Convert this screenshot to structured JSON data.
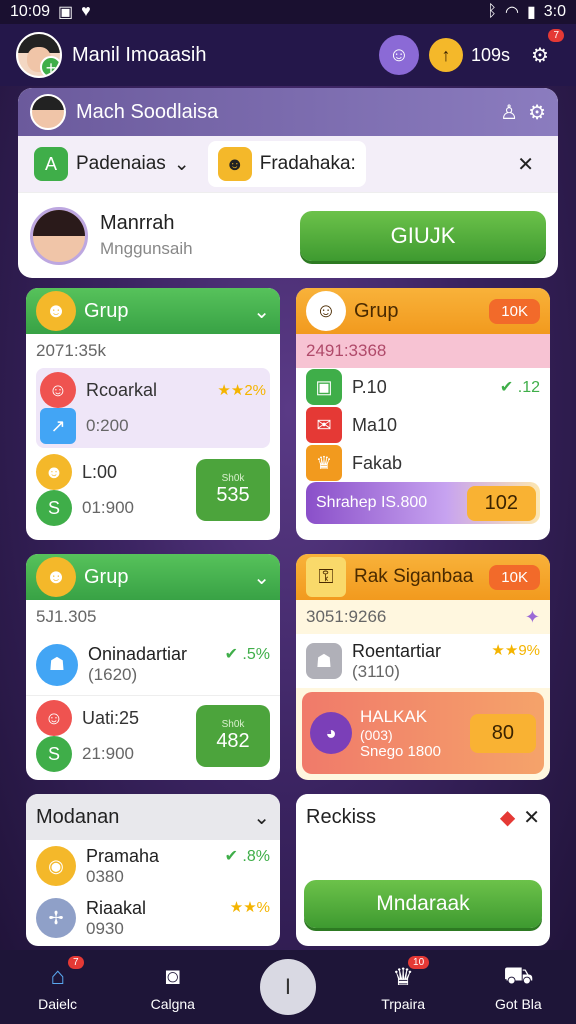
{
  "status": {
    "time": "10:09",
    "right": "3:0"
  },
  "topbar": {
    "username": "Manil Imoaasih",
    "coins": "109s",
    "notif_badge": "7"
  },
  "panel": {
    "title": "Mach Soodlaisa",
    "tab1": "Padenaias",
    "tab2": "Fradahaka:",
    "profile_name": "Manrrah",
    "profile_sub": "Mnggunsaih",
    "action_button": "GIUJK"
  },
  "card1": {
    "title": "Grup",
    "subtitle": "2071:35k",
    "row1_label": "Rcoarkal",
    "row1_stars": "★★2%",
    "row1_sub": "0:200",
    "row2_label": "L:00",
    "row2_sub": "01:900",
    "value_small": "Sh0k",
    "value": "535"
  },
  "card2": {
    "title": "Grup",
    "pill": "10K",
    "subtitle": "2491:3368",
    "row1_label": "P.10",
    "row1_check": "✔ .12",
    "row2_label": "Ma10",
    "row3_label": "Fakab",
    "promo_label": "Shrahep IS.800",
    "promo_value": "102"
  },
  "card3": {
    "title": "Grup",
    "subtitle": "5J1.305",
    "row1_label": "Oninadartiar",
    "row1_check": "✔ .5%",
    "row1_sub": "(1620)",
    "row2_label": "Uati:25",
    "row2_sub": "21:900",
    "value_small": "Sh0k",
    "value": "482"
  },
  "card4": {
    "title": "Rak Siganbaa",
    "pill": "10K",
    "subtitle": "3051:9266",
    "row1_label": "Roentartiar",
    "row1_stars": "★★9%",
    "row1_sub": "(3110)",
    "row2_label": "HALKAK",
    "row2_sub": "(003)",
    "row2_sub2": "Snego 1800",
    "row2_value": "80"
  },
  "card5": {
    "title": "Modanan",
    "row1_label": "Pramaha",
    "row1_check": "✔ .8%",
    "row1_sub": "0380",
    "row2_label": "Riaakal",
    "row2_stars": "★★%",
    "row2_sub": "0930"
  },
  "card6": {
    "title": "Reckiss",
    "button": "Mndaraak"
  },
  "nav": {
    "item1": "Daielc",
    "item2": "Calgna",
    "center": "I",
    "item3": "Trpaira",
    "item4": "Got Bla",
    "badge1": "7",
    "badge3": "10"
  },
  "colors": {
    "green": "#4ca43c",
    "orange": "#f29a1e",
    "purple": "#24174a"
  }
}
